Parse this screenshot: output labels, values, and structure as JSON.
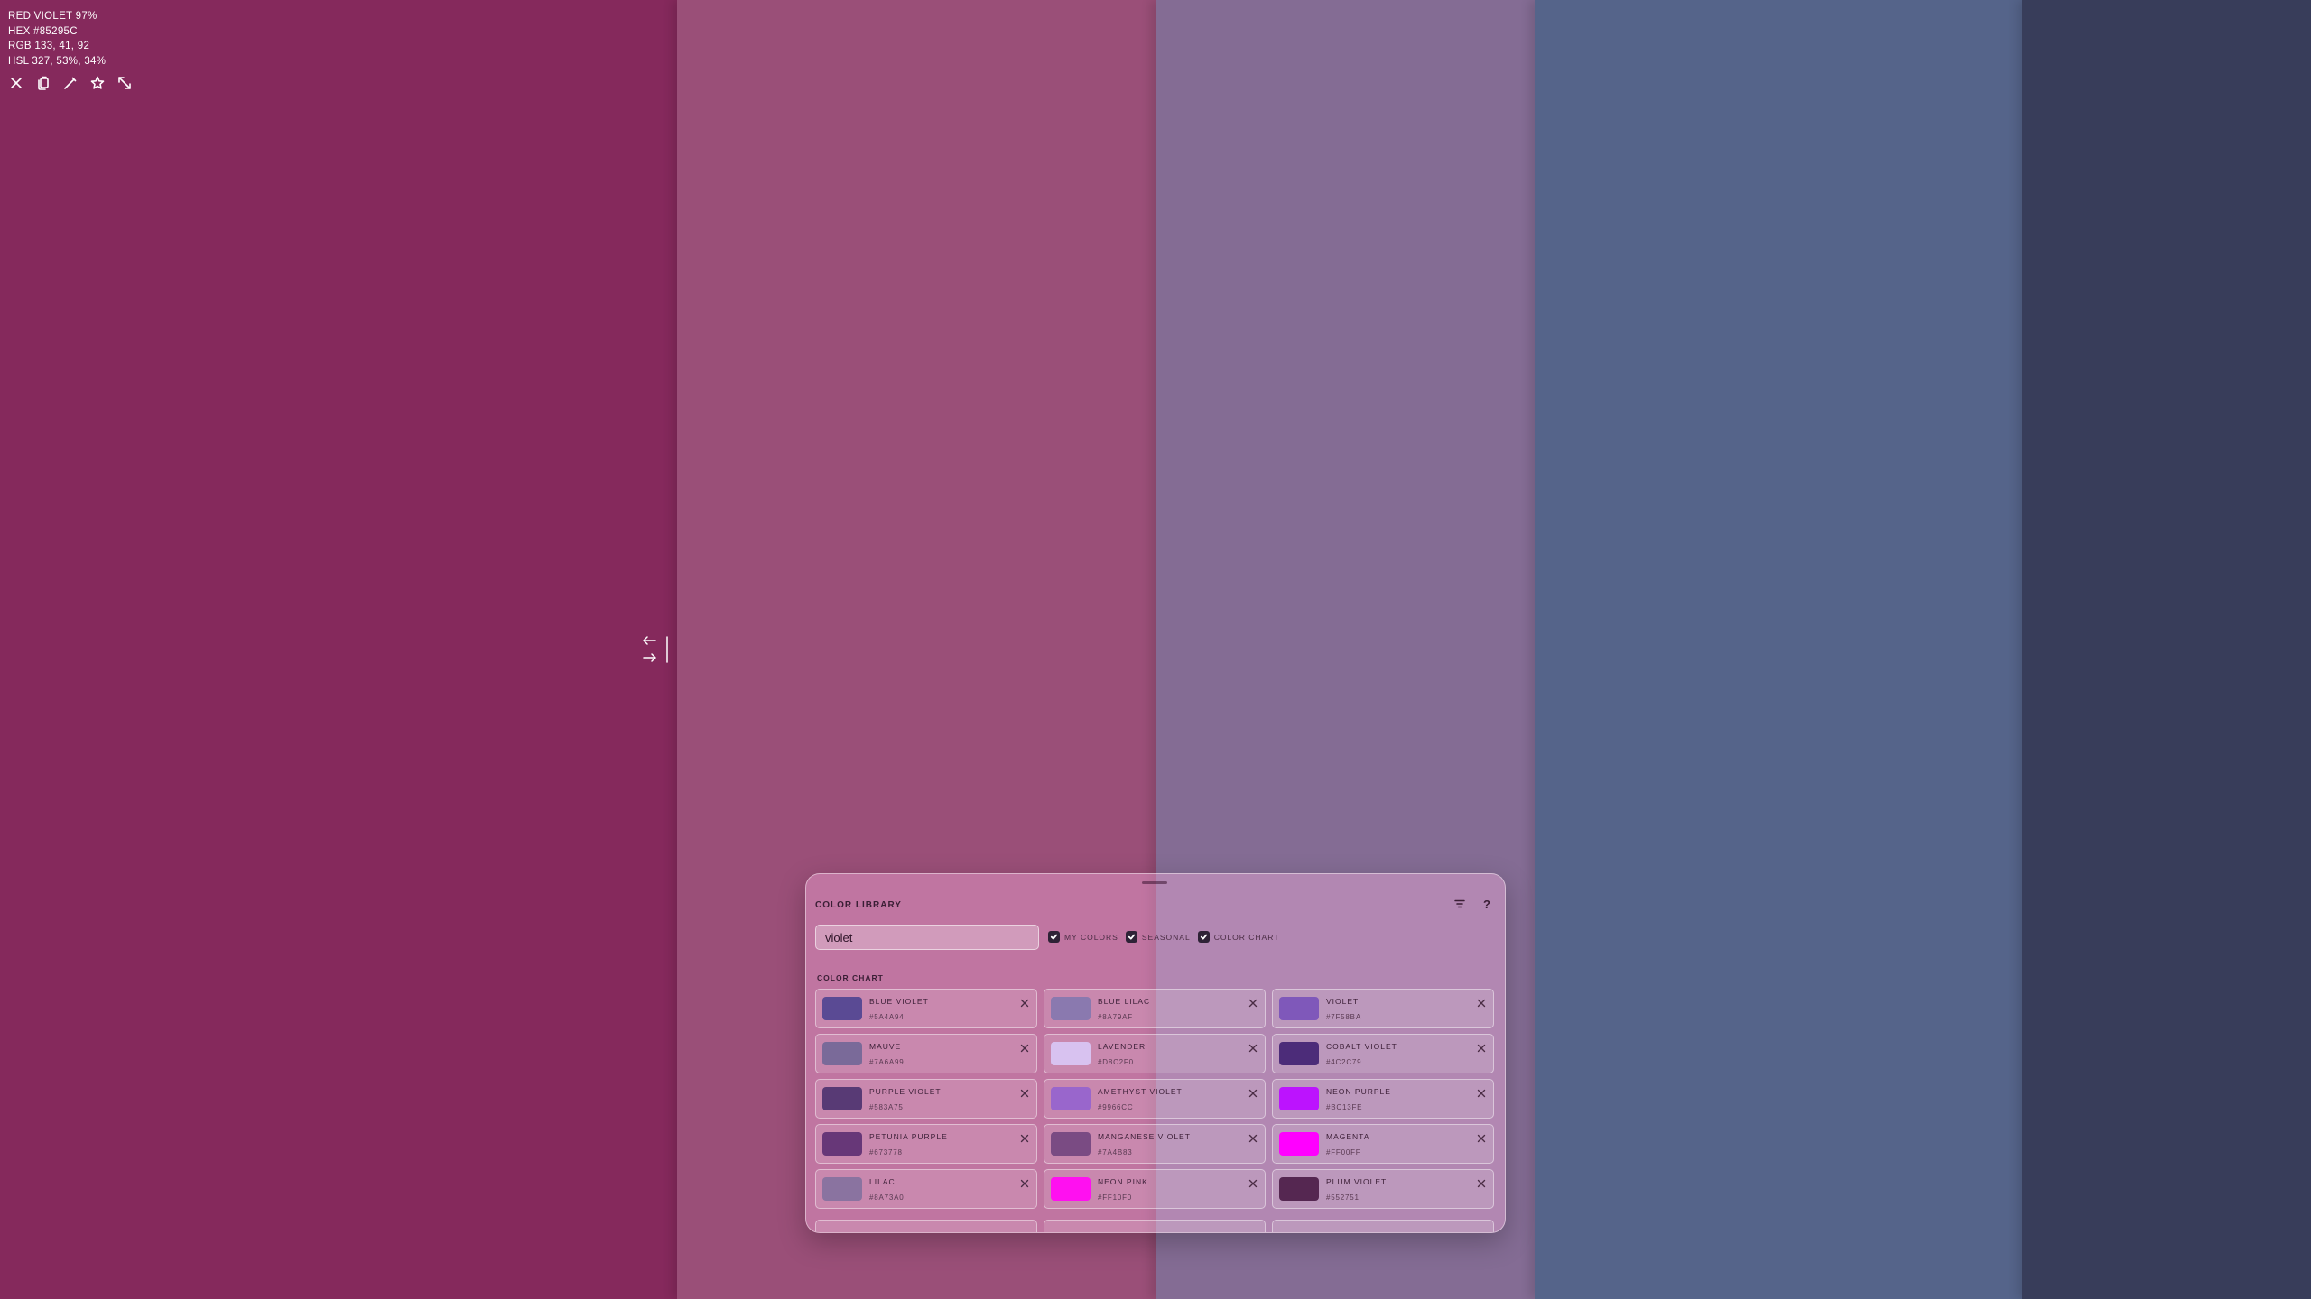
{
  "background_panels": [
    {
      "color": "#85295C"
    },
    {
      "color": "#9A4F78"
    },
    {
      "color": "#846C94"
    },
    {
      "color": "#55648A"
    },
    {
      "color": "#383D5A"
    }
  ],
  "color_info": {
    "name_line": "RED VIOLET 97%",
    "hex_line": "HEX #85295C",
    "rgb_line": "RGB 133, 41, 92",
    "hsl_line": "HSL 327, 53%, 34%"
  },
  "toolbar": {
    "icons": [
      "close-icon",
      "copy-icon",
      "eyedropper-icon",
      "star-icon",
      "expand-icon"
    ]
  },
  "library": {
    "title": "COLOR LIBRARY",
    "icons": [
      "filter-icon",
      "help-icon"
    ],
    "help_label": "?",
    "search": {
      "value": "violet",
      "placeholder": ""
    },
    "filters": [
      {
        "label": "MY COLORS",
        "checked": true
      },
      {
        "label": "SEASONAL",
        "checked": true
      },
      {
        "label": "COLOR CHART",
        "checked": true
      }
    ],
    "section_title": "COLOR CHART",
    "colors": [
      {
        "name": "BLUE VIOLET",
        "hex": "#5A4A94"
      },
      {
        "name": "BLUE LILAC",
        "hex": "#8A79AF"
      },
      {
        "name": "VIOLET",
        "hex": "#7F58BA"
      },
      {
        "name": "MAUVE",
        "hex": "#7A6A99"
      },
      {
        "name": "LAVENDER",
        "hex": "#D8C2F0"
      },
      {
        "name": "COBALT VIOLET",
        "hex": "#4C2C79"
      },
      {
        "name": "PURPLE VIOLET",
        "hex": "#583A75"
      },
      {
        "name": "AMETHYST VIOLET",
        "hex": "#9966CC"
      },
      {
        "name": "NEON PURPLE",
        "hex": "#BC13FE"
      },
      {
        "name": "PETUNIA PURPLE",
        "hex": "#673778"
      },
      {
        "name": "MANGANESE VIOLET",
        "hex": "#7A4B83"
      },
      {
        "name": "MAGENTA",
        "hex": "#FF00FF"
      },
      {
        "name": "LILAC",
        "hex": "#8A73A0"
      },
      {
        "name": "NEON PINK",
        "hex": "#FF10F0"
      },
      {
        "name": "PLUM VIOLET",
        "hex": "#552751"
      }
    ]
  }
}
